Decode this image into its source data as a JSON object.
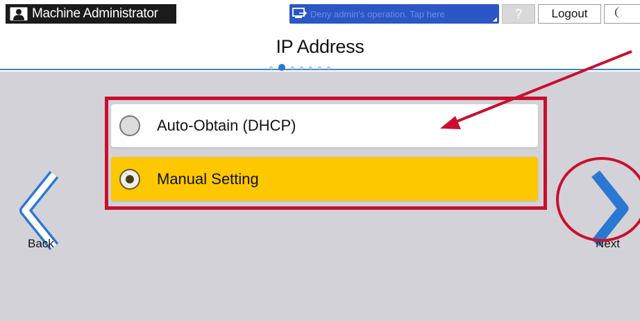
{
  "header": {
    "user_name": "Machine Administrator",
    "ops_text": "Deny admin's operation. Tap here",
    "help_label": "?",
    "logout_label": "Logout",
    "icons": {
      "user": "person-icon",
      "ops": "remote-operation-icon",
      "moon": "energy-saver-moon-icon"
    }
  },
  "page": {
    "title": "IP Address",
    "step_indicator": {
      "total": 7,
      "current": 2
    }
  },
  "options": [
    {
      "label": "Auto-Obtain (DHCP)",
      "selected": false
    },
    {
      "label": "Manual Setting",
      "selected": true
    }
  ],
  "navigation": {
    "back_label": "Back",
    "next_label": "Next"
  },
  "colors": {
    "selected_option": "#fdc800",
    "accent_blue": "#2a78d1",
    "annotation_red": "#c8102e",
    "background": "#d3d2d8"
  }
}
